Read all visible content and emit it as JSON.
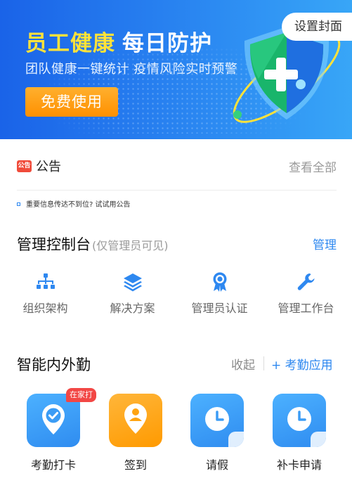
{
  "banner": {
    "title_highlight": "员工健康",
    "title_rest": "每日防护",
    "subtitle": "团队健康一键统计 疫情风险实时预警",
    "cta_label": "免费使用",
    "set_cover_label": "设置封面"
  },
  "announcement": {
    "tag": "公告",
    "title": "公告",
    "view_all": "查看全部",
    "item": "重要信息传达不到位? 试试用公告"
  },
  "admin": {
    "title": "管理控制台",
    "note": "(仅管理员可见)",
    "manage_link": "管理",
    "items": [
      {
        "label": "组织架构",
        "icon": "org-structure-icon"
      },
      {
        "label": "解决方案",
        "icon": "layers-icon"
      },
      {
        "label": "管理员认证",
        "icon": "certified-badge-icon"
      },
      {
        "label": "管理工作台",
        "icon": "wrench-icon"
      }
    ]
  },
  "attendance": {
    "title": "智能内外勤",
    "collapse": "收起",
    "app_link": "+ 考勤应用",
    "apps": [
      {
        "label": "考勤打卡",
        "badge": "在家打",
        "icon": "checkin-location-icon"
      },
      {
        "label": "签到",
        "icon": "sign-in-pin-icon"
      },
      {
        "label": "请假",
        "icon": "clock-icon"
      },
      {
        "label": "补卡申请",
        "icon": "clock-icon"
      }
    ]
  },
  "colors": {
    "accent": "#2e88f0",
    "banner_yellow": "#ffe23a",
    "cta_orange": "#ff9a00",
    "badge_red": "#f24745"
  }
}
